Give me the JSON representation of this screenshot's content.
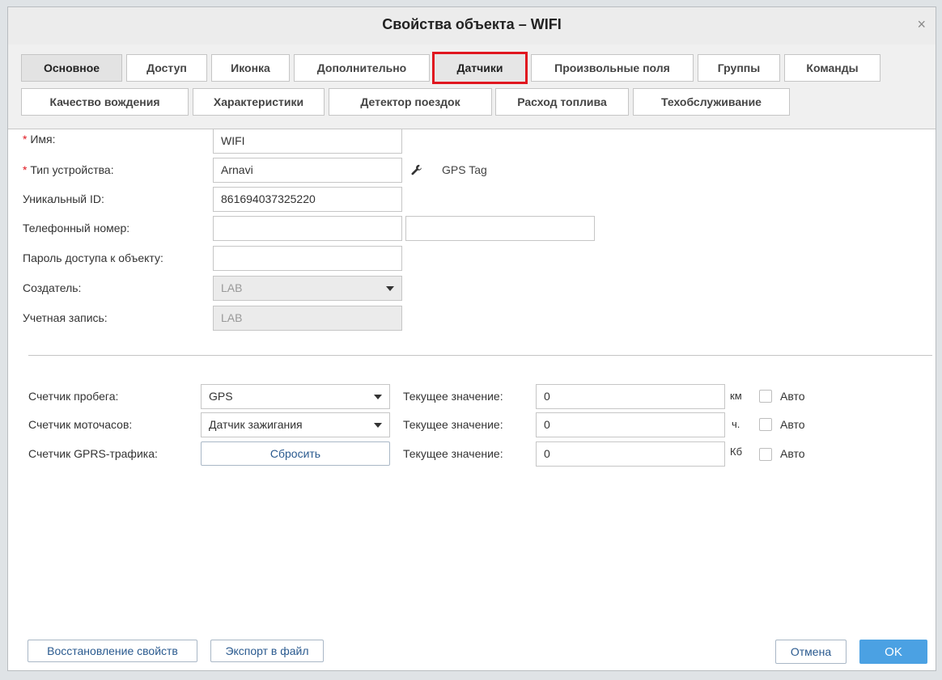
{
  "window": {
    "title": "Свойства объекта – WIFI",
    "close_label": "×"
  },
  "tabs": {
    "row1": [
      {
        "label": "Основное"
      },
      {
        "label": "Доступ"
      },
      {
        "label": "Иконка"
      },
      {
        "label": "Дополнительно"
      },
      {
        "label": "Датчики"
      },
      {
        "label": "Произвольные поля"
      },
      {
        "label": "Группы"
      },
      {
        "label": "Команды"
      }
    ],
    "row2": [
      {
        "label": "Качество вождения"
      },
      {
        "label": "Характеристики"
      },
      {
        "label": "Детектор поездок"
      },
      {
        "label": "Расход топлива"
      },
      {
        "label": "Техобслуживание"
      }
    ],
    "active": "Основное",
    "highlighted": "Датчики",
    "highlight_color": "#e0161f"
  },
  "form": {
    "required_mark": "*",
    "name": {
      "label": "Имя:",
      "value": "WIFI"
    },
    "device_type": {
      "label": "Тип устройства:",
      "value": "Arnavi",
      "extra": "GPS Tag",
      "icon": "wrench-icon"
    },
    "unique_id": {
      "label": "Уникальный ID:",
      "value": "861694037325220"
    },
    "phone": {
      "label": "Телефонный номер:",
      "value": "",
      "value2": ""
    },
    "password": {
      "label": "Пароль доступа к объекту:",
      "value": ""
    },
    "creator": {
      "label": "Создатель:",
      "value": "LAB"
    },
    "account": {
      "label": "Учетная запись:",
      "value": "LAB"
    }
  },
  "counters": {
    "mileage": {
      "label": "Счетчик пробега:",
      "select": "GPS",
      "current_label": "Текущее значение:",
      "current_value": "0",
      "unit": "км",
      "auto_label": "Авто",
      "auto_checked": false
    },
    "engine_hours": {
      "label": "Счетчик моточасов:",
      "select": "Датчик зажигания",
      "current_label": "Текущее значение:",
      "current_value": "0",
      "unit": "ч.",
      "auto_label": "Авто",
      "auto_checked": false
    },
    "gprs": {
      "label": "Счетчик GPRS-трафика:",
      "reset_label": "Сбросить",
      "current_label": "Текущее значение:",
      "current_value": "0",
      "unit": "Кб",
      "auto_label": "Авто",
      "auto_checked": false
    }
  },
  "footer": {
    "restore_label": "Восстановление свойств",
    "export_label": "Экспорт в файл",
    "cancel_label": "Отмена",
    "ok_label": "OK",
    "ok_color": "#4ba1e3"
  }
}
